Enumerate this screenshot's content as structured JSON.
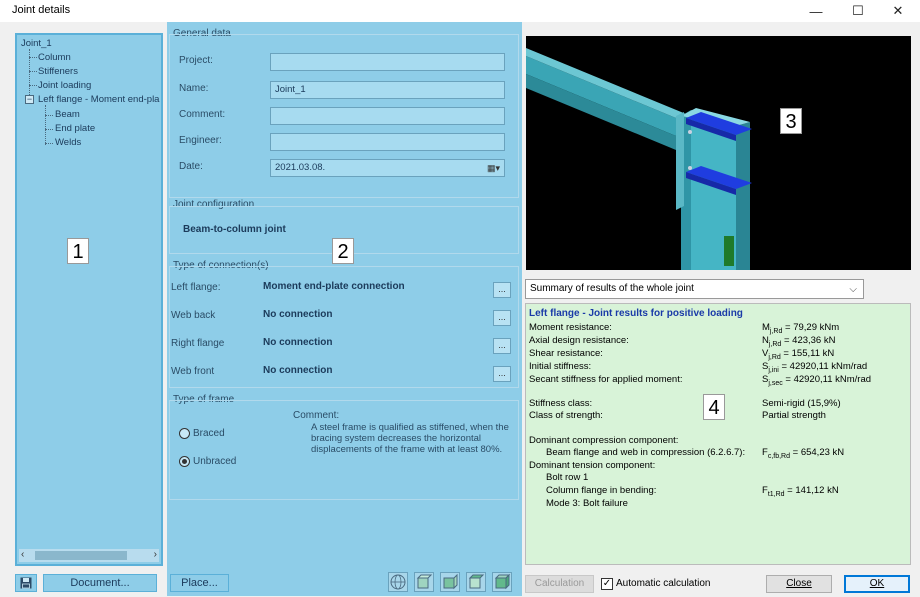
{
  "window": {
    "title": "Joint details",
    "minimize_glyph": "—",
    "maximize_glyph": "☐",
    "close_glyph": "✕"
  },
  "tree": {
    "root": "Joint_1",
    "items": [
      "Column",
      "Stiffeners",
      "Joint loading",
      "Left flange - Moment end-pla"
    ],
    "sub_items": [
      "Beam",
      "End plate",
      "Welds"
    ],
    "collapse_glyph": "−"
  },
  "panel_numbers": [
    "1",
    "2",
    "3",
    "4"
  ],
  "buttons": {
    "document": "Document...",
    "place": "Place...",
    "calculation": "Calculation",
    "close": "Close",
    "ok": "OK",
    "dots": "..."
  },
  "general": {
    "title": "General data",
    "project_label": "Project:",
    "project_value": "",
    "name_label": "Name:",
    "name_value": "Joint_1",
    "comment_label": "Comment:",
    "comment_value": "",
    "engineer_label": "Engineer:",
    "engineer_value": "",
    "date_label": "Date:",
    "date_value": "2021.03.08."
  },
  "joint_config": {
    "title": "Joint configuration",
    "value": "Beam-to-column joint"
  },
  "connections": {
    "title": "Type of connection(s)",
    "rows": [
      {
        "label": "Left flange:",
        "value": "Moment end-plate connection"
      },
      {
        "label": "Web back",
        "value": "No connection"
      },
      {
        "label": "Right flange",
        "value": "No connection"
      },
      {
        "label": "Web front",
        "value": "No connection"
      }
    ]
  },
  "frame": {
    "title": "Type of frame",
    "braced": "Braced",
    "unbraced": "Unbraced",
    "selected": "Unbraced",
    "comment_label": "Comment:",
    "comment_text": "A steel frame is qualified as stiffened, when the bracing system decreases the horizontal displacements of the frame with at least 80%."
  },
  "summary_select": {
    "selected": "Summary of results of the whole joint"
  },
  "results": {
    "heading": "Left flange - Joint results for positive loading",
    "rows": [
      {
        "label": "Moment resistance:",
        "sym": "M",
        "sub": "j,Rd",
        "value": " = 79,29 kNm"
      },
      {
        "label": "Axial design resistance:",
        "sym": "N",
        "sub": "j,Rd",
        "value": " = 423,36 kN"
      },
      {
        "label": "Shear resistance:",
        "sym": "V",
        "sub": "j,Rd",
        "value": " = 155,11 kN"
      },
      {
        "label": "Initial stiffness:",
        "sym": "S",
        "sub": "j,ini",
        "value": " = 42920,11 kNm/rad"
      },
      {
        "label": "Secant stiffness for applied moment:",
        "sym": "S",
        "sub": "j,sec",
        "value": " = 42920,11 kNm/rad"
      }
    ],
    "stiffness_class_label": "Stiffness class:",
    "stiffness_class_value": "Semi-rigid (15,9%)",
    "strength_class_label": "Class of strength:",
    "strength_class_value": "Partial strength",
    "dominant_compression": "Dominant compression component:",
    "compression_item": "Beam flange and web in compression (6.2.6.7):",
    "compression_sym": "F",
    "compression_sub": "c,fb,Rd",
    "compression_value": " = 654,23 kN",
    "dominant_tension": "Dominant tension component:",
    "bolt_row": "Bolt row 1",
    "tension_item": "Column flange in bending:",
    "tension_sym": "F",
    "tension_sub": "t1,Rd",
    "tension_value": " = 141,12 kN",
    "mode": "Mode 3: Bolt failure"
  },
  "auto_calc": {
    "label": "Automatic calculation",
    "checked": true,
    "check_glyph": "✓"
  },
  "colors": {
    "overlay": "#8ecde8",
    "results_bg": "#d8f3d8",
    "results_heading": "#1a3aa8",
    "beam": "#3aa5b5",
    "plate": "#1f3de0"
  }
}
